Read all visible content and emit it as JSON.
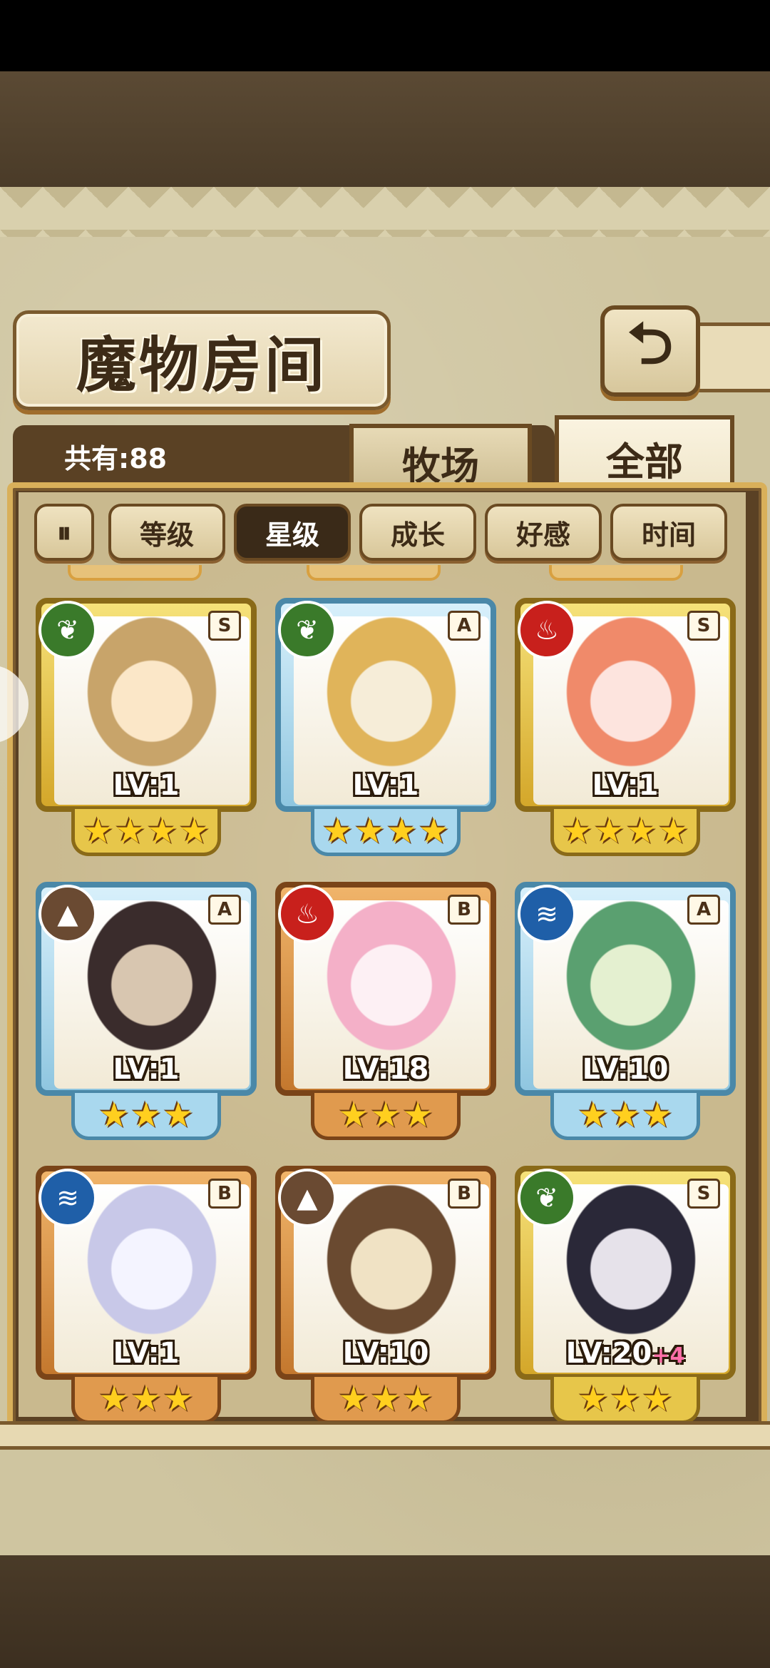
{
  "screen": {
    "title": "魔物房间",
    "back_icon": "back-return-icon",
    "count_label": "共有:88"
  },
  "tabs": [
    {
      "label": "牧场",
      "active": false
    },
    {
      "label": "全部",
      "active": true
    }
  ],
  "sort": {
    "toggle_label": "⏸",
    "buttons": [
      {
        "label": "等级",
        "active": false
      },
      {
        "label": "星级",
        "active": true
      },
      {
        "label": "成长",
        "active": false
      },
      {
        "label": "好感",
        "active": false
      },
      {
        "label": "时间",
        "active": false
      }
    ]
  },
  "cards": [
    {
      "element": "nature",
      "element_icon": "leaf-icon",
      "rank": "S",
      "frame": "gold",
      "level": "LV:1",
      "bonus": "",
      "stars": 4,
      "portrait": [
        "#fbe7c8",
        "#c8a46a"
      ]
    },
    {
      "element": "nature",
      "element_icon": "leaf-icon",
      "rank": "A",
      "frame": "blue",
      "level": "LV:1",
      "bonus": "",
      "stars": 4,
      "portrait": [
        "#f6edd8",
        "#e0b45a"
      ]
    },
    {
      "element": "fire",
      "element_icon": "flame-icon",
      "rank": "S",
      "frame": "gold",
      "level": "LV:1",
      "bonus": "",
      "stars": 4,
      "portrait": [
        "#fde4de",
        "#f08a6a"
      ]
    },
    {
      "element": "earth",
      "element_icon": "mountain-icon",
      "rank": "A",
      "frame": "blue",
      "level": "LV:1",
      "bonus": "",
      "stars": 3,
      "portrait": [
        "#d8c6b0",
        "#3a2c2c"
      ]
    },
    {
      "element": "fire",
      "element_icon": "flame-icon",
      "rank": "B",
      "frame": "bronze",
      "level": "LV:18",
      "bonus": "",
      "stars": 3,
      "portrait": [
        "#fdf0f4",
        "#f4b0c8"
      ]
    },
    {
      "element": "water",
      "element_icon": "waves-icon",
      "rank": "A",
      "frame": "blue",
      "level": "LV:10",
      "bonus": "",
      "stars": 3,
      "portrait": [
        "#e4f0d0",
        "#5aa070"
      ]
    },
    {
      "element": "water",
      "element_icon": "waves-icon",
      "rank": "B",
      "frame": "bronze",
      "level": "LV:1",
      "bonus": "",
      "stars": 3,
      "portrait": [
        "#f4f4ff",
        "#c8c8e8"
      ]
    },
    {
      "element": "earth",
      "element_icon": "mountain-icon",
      "rank": "B",
      "frame": "bronze",
      "level": "LV:10",
      "bonus": "",
      "stars": 3,
      "portrait": [
        "#f0e2c4",
        "#6a4a30"
      ]
    },
    {
      "element": "nature",
      "element_icon": "leaf-icon",
      "rank": "S",
      "frame": "gold",
      "level": "LV:20",
      "bonus": "+4",
      "stars": 3,
      "portrait": [
        "#e6e2ea",
        "#2a2838"
      ]
    }
  ]
}
